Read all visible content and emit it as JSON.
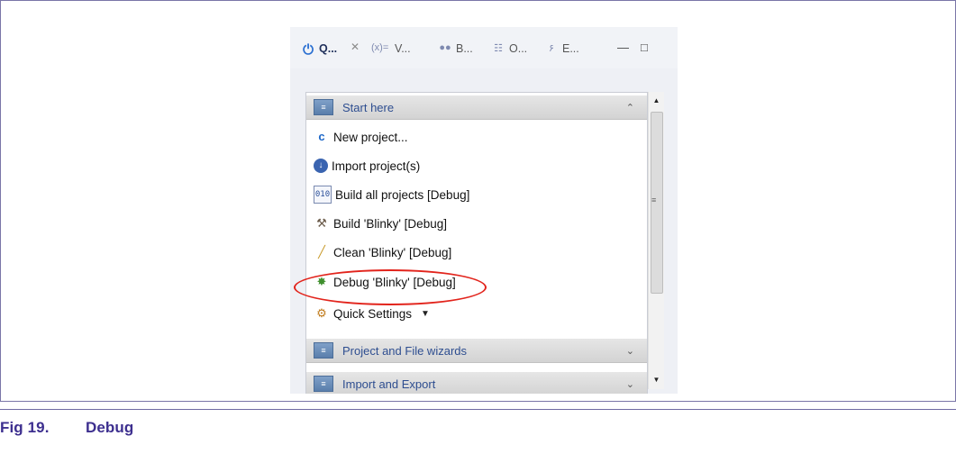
{
  "caption": {
    "number": "Fig 19.",
    "title": "Debug"
  },
  "tabs": [
    {
      "label": "Q...",
      "icon": "quickstart-icon",
      "active": true
    },
    {
      "label": "V...",
      "icon": "variables-icon"
    },
    {
      "label": "B...",
      "icon": "breakpoints-icon"
    },
    {
      "label": "O...",
      "icon": "outline-icon"
    },
    {
      "label": "E...",
      "icon": "expressions-icon"
    }
  ],
  "window_controls": {
    "minimize": "minimize-icon",
    "maximize": "maximize-icon"
  },
  "sections": [
    {
      "title": "Start here",
      "expanded": true
    },
    {
      "title": "Project and File wizards",
      "expanded": false
    },
    {
      "title": "Import and Export",
      "expanded": false
    }
  ],
  "items": [
    {
      "label": "New project...",
      "icon": "new-project-icon"
    },
    {
      "label": "Import project(s)",
      "icon": "import-icon"
    },
    {
      "label": "Build all projects [Debug]",
      "icon": "build-all-icon"
    },
    {
      "label": "Build 'Blinky' [Debug]",
      "icon": "hammer-icon"
    },
    {
      "label": "Clean 'Blinky' [Debug]",
      "icon": "broom-icon"
    },
    {
      "label": "Debug 'Blinky' [Debug]",
      "icon": "bug-icon",
      "highlighted": true
    },
    {
      "label": "Quick Settings",
      "icon": "settings-icon",
      "has_dropdown": true
    }
  ],
  "colors": {
    "highlight": "#e2241c",
    "caption": "#3d2f8f",
    "section_label": "#2e4e90"
  }
}
